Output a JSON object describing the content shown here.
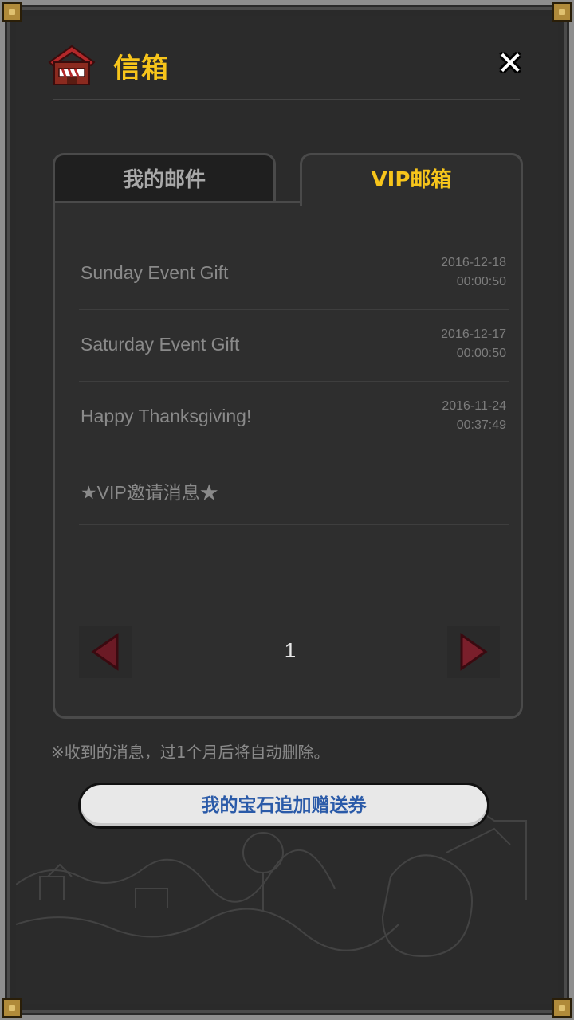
{
  "header": {
    "title": "信箱",
    "icon": "mailbox-house-icon",
    "close_icon": "close-icon",
    "close_label": "✕"
  },
  "tabs": [
    {
      "label": "我的邮件",
      "active": false
    },
    {
      "label": "VIP邮箱",
      "active": true
    }
  ],
  "mail_list": [
    {
      "title": "Sunday Event Gift",
      "date": "2016-12-18",
      "time": "00:00:50"
    },
    {
      "title": "Saturday Event Gift",
      "date": "2016-12-17",
      "time": "00:00:50"
    },
    {
      "title": "Happy Thanksgiving!",
      "date": "2016-11-24",
      "time": "00:37:49"
    },
    {
      "title": "★VIP邀请消息★",
      "date": "",
      "time": ""
    }
  ],
  "pagination": {
    "page": "1",
    "prev_icon": "arrow-left-icon",
    "next_icon": "arrow-right-icon"
  },
  "notice": "※收到的消息，过1个月后将自动删除。",
  "gift_button_label": "我的宝石追加赠送券",
  "colors": {
    "accent": "#f7c51b",
    "background": "#2b2b2b",
    "button_text": "#2a5aa8",
    "arrow": "#7a1f2b"
  }
}
